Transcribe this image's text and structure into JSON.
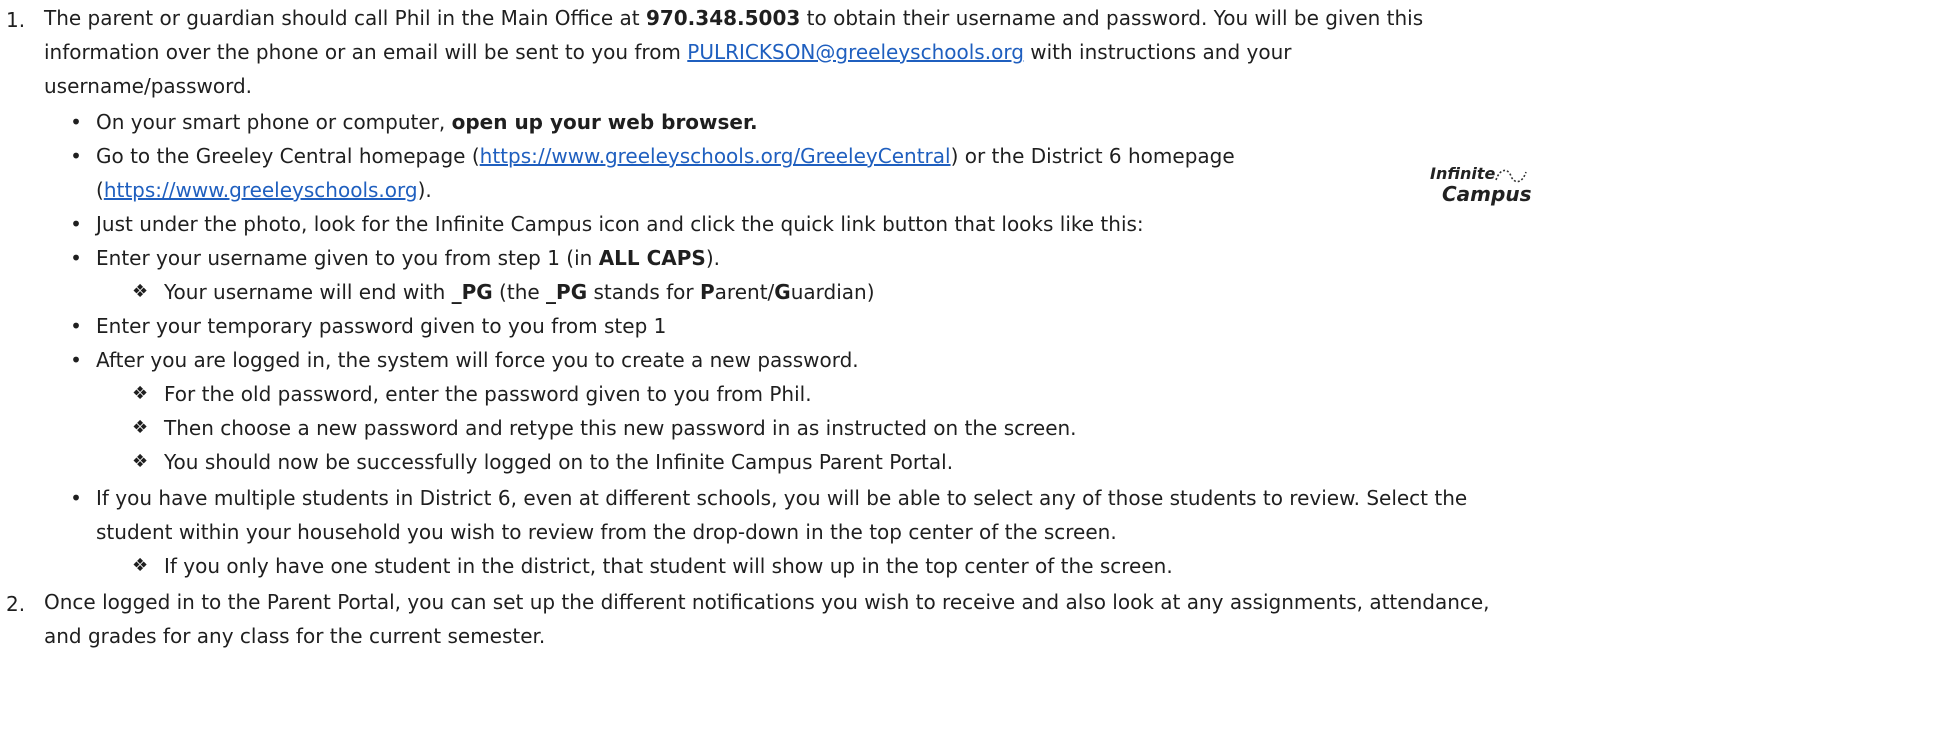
{
  "n1": "1.",
  "p1": {
    "a": "The parent or guardian should call Phil in the Main Office at ",
    "phone": "970.348.5003",
    "b": " to obtain their username and password. You will be given this",
    "l2a": "information over the phone or an email will be sent to you from ",
    "email": "PULRICKSON@greeleyschools.org",
    "l2b": " with instructions and your",
    "l3": "username/password."
  },
  "b1": {
    "a": "On your smart phone or computer, ",
    "bold": "open up your web browser."
  },
  "b2": {
    "a": "Go to the Greeley Central homepage (",
    "link1": "https://www.greeleyschools.org/GreeleyCentral",
    "b": ") or the District 6 homepage",
    "l2a": "(",
    "link2": "https://www.greeleyschools.org",
    "l2b": ")."
  },
  "b3": "Just under the photo, look for the Infinite Campus icon and click the quick link button that looks like this:",
  "logo": {
    "t1": "Infinite",
    "t2": "Campus"
  },
  "b4": {
    "a": "Enter your username given to you from step 1 (in ",
    "bold": "ALL CAPS",
    "b": ")."
  },
  "d1": {
    "a": "Your username will end with ",
    "pg1": "_PG",
    "b": " (the ",
    "pg2": "_PG",
    "c": " stands for ",
    "p": "P",
    "d": "arent/",
    "g": "G",
    "e": "uardian)"
  },
  "b5": "Enter your temporary password given to you from step 1",
  "b6": "After you are logged in, the system will force you to create a new password.",
  "d2": "For the old password, enter the password given to you from Phil.",
  "d3": "Then choose a new password and retype this new password in as instructed on the screen.",
  "d4": "You should now be successfully logged on to the Infinite Campus Parent Portal.",
  "b7": {
    "l1": "If you have multiple students in District 6, even at different schools, you will be able to select any of those students to review. Select the",
    "l2": "student within your household you wish to review from the drop-down in the top center of the screen."
  },
  "d5": "If you only have one student in the district, that student will show up in the top center of the screen.",
  "n2": "2.",
  "p2": {
    "l1": "Once logged in to the Parent Portal, you can set up the different notifications you wish to receive and also look at any assignments, attendance,",
    "l2": "and grades for any class for the current semester."
  },
  "bullet_char": "•",
  "diamond_char": "❖",
  "colors": {
    "link": "#1f5fbf",
    "text": "#1f1f1f"
  }
}
